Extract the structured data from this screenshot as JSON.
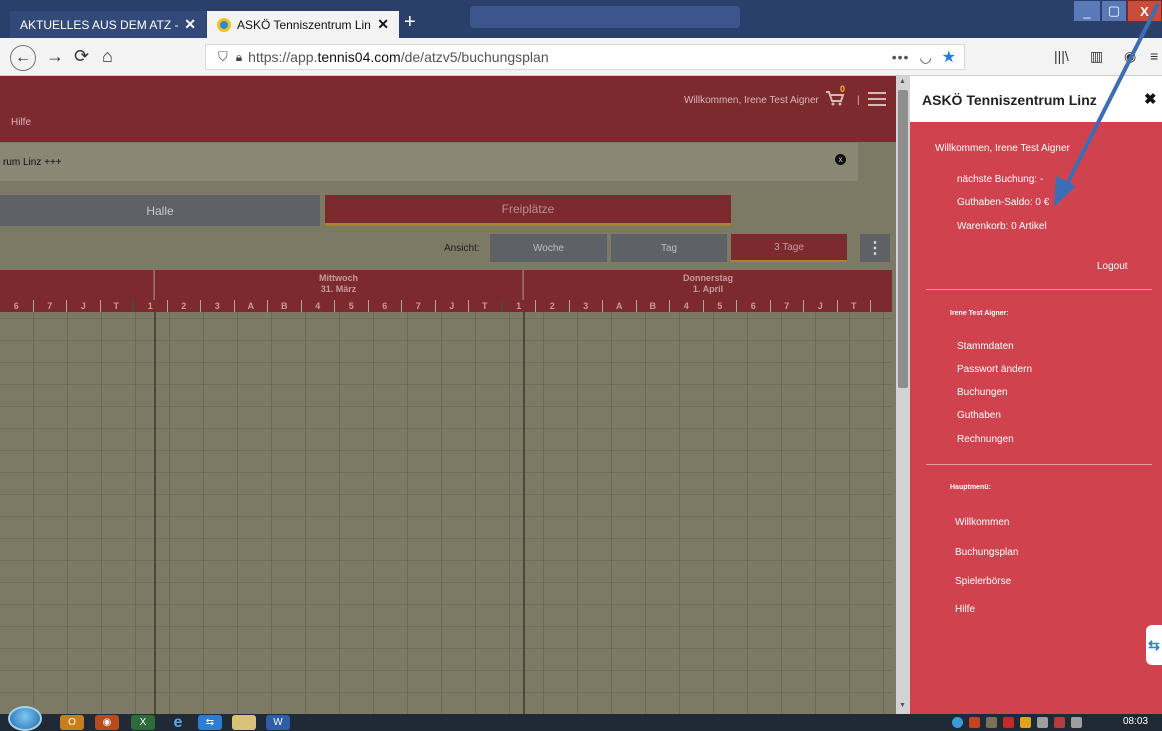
{
  "browser": {
    "tabs": [
      {
        "title": "AKTUELLES AUS DEM ATZ - at",
        "active": false
      },
      {
        "title": "ASKÖ Tenniszentrum Linz - Che",
        "active": true
      }
    ],
    "newtab": "+",
    "url_prefix": "https://app.",
    "url_domain": "tennis04.com",
    "url_path": "/de/atzv5/buchungsplan",
    "more": "•••",
    "win_min": "_",
    "win_max": "▢",
    "win_close": "X"
  },
  "header": {
    "hilfe": "Hilfe",
    "welcome": "Willkommen, Irene Test Aigner",
    "cart_count": "0",
    "sep": "|"
  },
  "notice": {
    "text": "rum Linz +++",
    "close": "x"
  },
  "segments": {
    "halle": "Halle",
    "freiplaetze": "Freiplätze"
  },
  "view": {
    "label": "Ansicht:",
    "woche": "Woche",
    "tag": "Tag",
    "drei_tage": "3 Tage",
    "more": "⋮"
  },
  "days": [
    {
      "name": "",
      "date": ""
    },
    {
      "name": "Mittwoch",
      "date": "31. März"
    },
    {
      "name": "Donnerstag",
      "date": "1. April"
    }
  ],
  "courts_partial": [
    "6",
    "7",
    "J",
    "T"
  ],
  "courts": [
    "1",
    "2",
    "3",
    "A",
    "B",
    "4",
    "5",
    "6",
    "7",
    "J",
    "T"
  ],
  "panel": {
    "title": "ASKÖ Tenniszentrum Linz",
    "close": "✖",
    "welcome": "Willkommen, Irene Test Aigner",
    "next_booking": "nächste Buchung: -",
    "balance": "Guthaben-Saldo: 0 €",
    "cart": "Warenkorb: 0 Artikel",
    "logout": "Logout",
    "user_heading": "Irene Test Aigner:",
    "user_links": [
      "Stammdaten",
      "Passwort ändern",
      "Buchungen",
      "Guthaben",
      "Rechnungen"
    ],
    "main_heading": "Hauptmenü:",
    "main_links": [
      "Willkommen",
      "Buchungsplan",
      "Spielerbörse",
      "Hilfe"
    ]
  },
  "taskbar": {
    "clock": "08:03"
  },
  "colors": {
    "accent": "#d0434e",
    "header": "#7d2a2e",
    "arrow": "#3d6db5"
  }
}
